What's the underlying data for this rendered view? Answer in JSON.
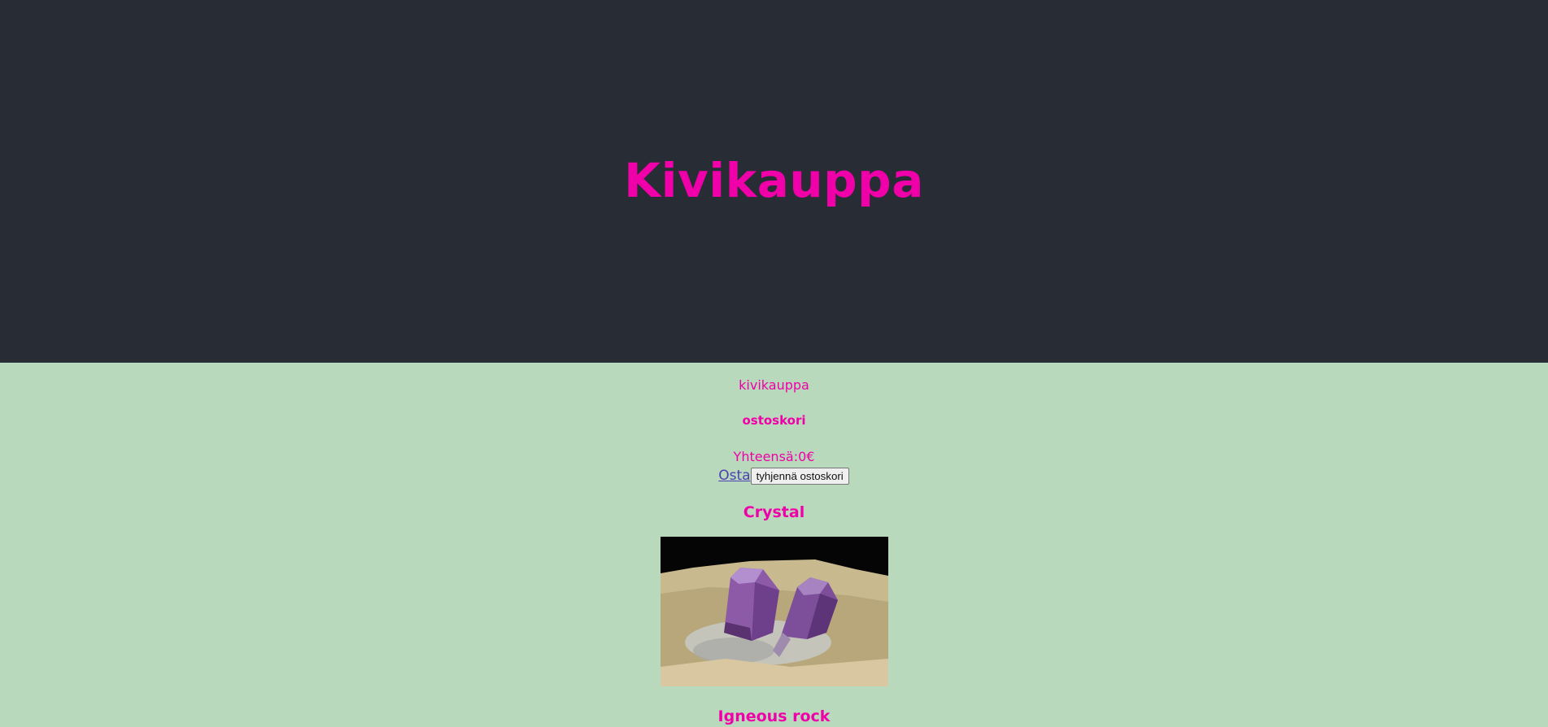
{
  "header": {
    "title": "Kivikauppa"
  },
  "nav": {
    "home_link": "kivikauppa"
  },
  "cart": {
    "heading": "ostoskori",
    "total": "Yhteensä:0€",
    "buy_link": "Osta",
    "clear_button": "tyhjennä ostoskori"
  },
  "products": [
    {
      "name": "Crystal",
      "image_icon": "amethyst-crystal-photo"
    },
    {
      "name": "Igneous rock"
    }
  ],
  "colors": {
    "accent": "#f000a8",
    "header_bg": "#282c34",
    "page_bg": "#b9d9bc",
    "link": "#4c3fb0"
  }
}
